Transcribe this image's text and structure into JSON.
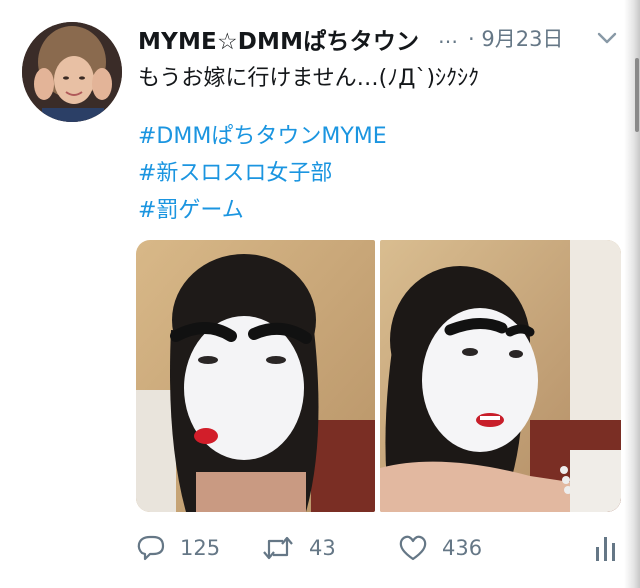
{
  "tweet": {
    "display_name": "MYME☆DMMぱちタウン",
    "truncation": "…",
    "timestamp": "· 9月23日",
    "text": "もうお嫁に行けません…(ﾉД`)ｼｸｼｸ",
    "hashtags": [
      "#DMMぱちタウンMYME",
      "#新スロスロ女子部",
      "#罰ゲーム"
    ],
    "photos": [
      {
        "icon": "photo-woman-white-face-pursed-lips"
      },
      {
        "icon": "photo-woman-white-face-smiling"
      }
    ]
  },
  "actions": {
    "reply": {
      "icon": "reply-icon",
      "count": "125"
    },
    "retweet": {
      "icon": "retweet-icon",
      "count": "43"
    },
    "like": {
      "icon": "heart-icon",
      "count": "436"
    },
    "analytics": {
      "icon": "analytics-icon"
    }
  },
  "colors": {
    "text": "#14171a",
    "secondary": "#657786",
    "link": "#1b95e0",
    "background": "#ffffff"
  }
}
